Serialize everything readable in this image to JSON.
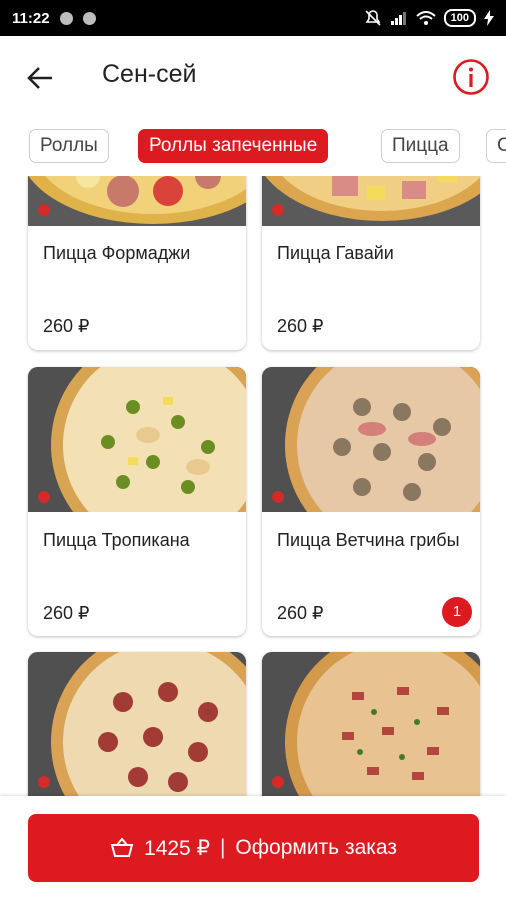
{
  "status_bar": {
    "time": "11:22",
    "battery": "100"
  },
  "app_bar": {
    "title": "Сен-сей",
    "back_icon": "arrow-left-icon",
    "info_icon": "info-circle-icon"
  },
  "tabs": [
    {
      "label": "Роллы",
      "active": false
    },
    {
      "label": "Роллы запеченные",
      "active": true
    },
    {
      "label": "Пицца",
      "active": false
    },
    {
      "label": "С",
      "active": false
    }
  ],
  "products": [
    {
      "name": "Пицца Формаджи",
      "price": "260 ₽"
    },
    {
      "name": "Пицца Гавайи",
      "price": "260 ₽"
    },
    {
      "name": "Пицца Тропикана",
      "price": "260 ₽"
    },
    {
      "name": "Пицца Ветчина грибы",
      "price": "260 ₽",
      "badge": "1"
    },
    {
      "name": "",
      "price": ""
    },
    {
      "name": "",
      "price": ""
    }
  ],
  "order_button": {
    "total": "1425 ₽",
    "separator": "|",
    "label": "Оформить заказ",
    "icon": "basket-icon"
  },
  "colors": {
    "accent": "#dd1a1f"
  }
}
